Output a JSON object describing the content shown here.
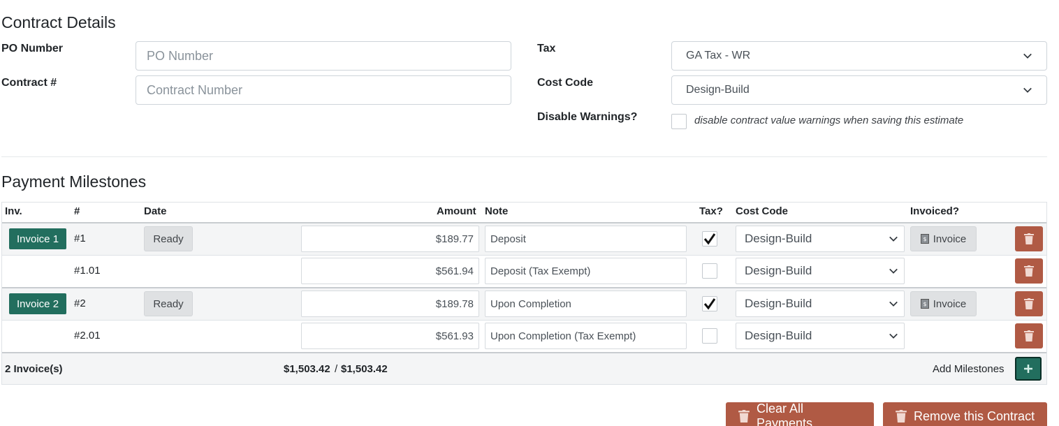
{
  "contract": {
    "heading": "Contract Details",
    "po_label": "PO Number",
    "po_placeholder": "PO Number",
    "contract_label": "Contract #",
    "contract_placeholder": "Contract Number",
    "tax_label": "Tax",
    "tax_value": "GA Tax - WR",
    "cost_code_label": "Cost Code",
    "cost_code_value": "Design-Build",
    "disable_label": "Disable Warnings?",
    "disable_hint": "disable contract value warnings when saving this estimate"
  },
  "milestones": {
    "heading": "Payment Milestones",
    "headers": {
      "inv": "Inv.",
      "num": "#",
      "date": "Date",
      "amount": "Amount",
      "note": "Note",
      "tax": "Tax?",
      "cost_code": "Cost Code",
      "invoiced": "Invoiced?"
    },
    "rows": [
      {
        "invoice": "Invoice 1",
        "num": "#1",
        "date": "Ready",
        "amount": "$189.77",
        "note": "Deposit",
        "taxed": true,
        "cost_code": "Design-Build",
        "invoiced_btn": "Invoice"
      },
      {
        "invoice": "",
        "num": "#1.01",
        "date": "",
        "amount": "$561.94",
        "note": "Deposit (Tax Exempt)",
        "taxed": false,
        "cost_code": "Design-Build",
        "invoiced_btn": ""
      },
      {
        "invoice": "Invoice 2",
        "num": "#2",
        "date": "Ready",
        "amount": "$189.78",
        "note": "Upon Completion",
        "taxed": true,
        "cost_code": "Design-Build",
        "invoiced_btn": "Invoice"
      },
      {
        "invoice": "",
        "num": "#2.01",
        "date": "",
        "amount": "$561.93",
        "note": "Upon Completion (Tax Exempt)",
        "taxed": false,
        "cost_code": "Design-Build",
        "invoiced_btn": ""
      }
    ],
    "footer": {
      "invoice_count": "2 Invoice(s)",
      "total_allocated": "$1,503.42",
      "separator": "/",
      "total_contract": "$1,503.42",
      "add_label": "Add Milestones"
    }
  },
  "actions": {
    "clear_label": "Clear All Payments",
    "remove_label": "Remove this Contract"
  },
  "colors": {
    "primary_green": "#226e5e",
    "danger_brown": "#b05a44"
  }
}
